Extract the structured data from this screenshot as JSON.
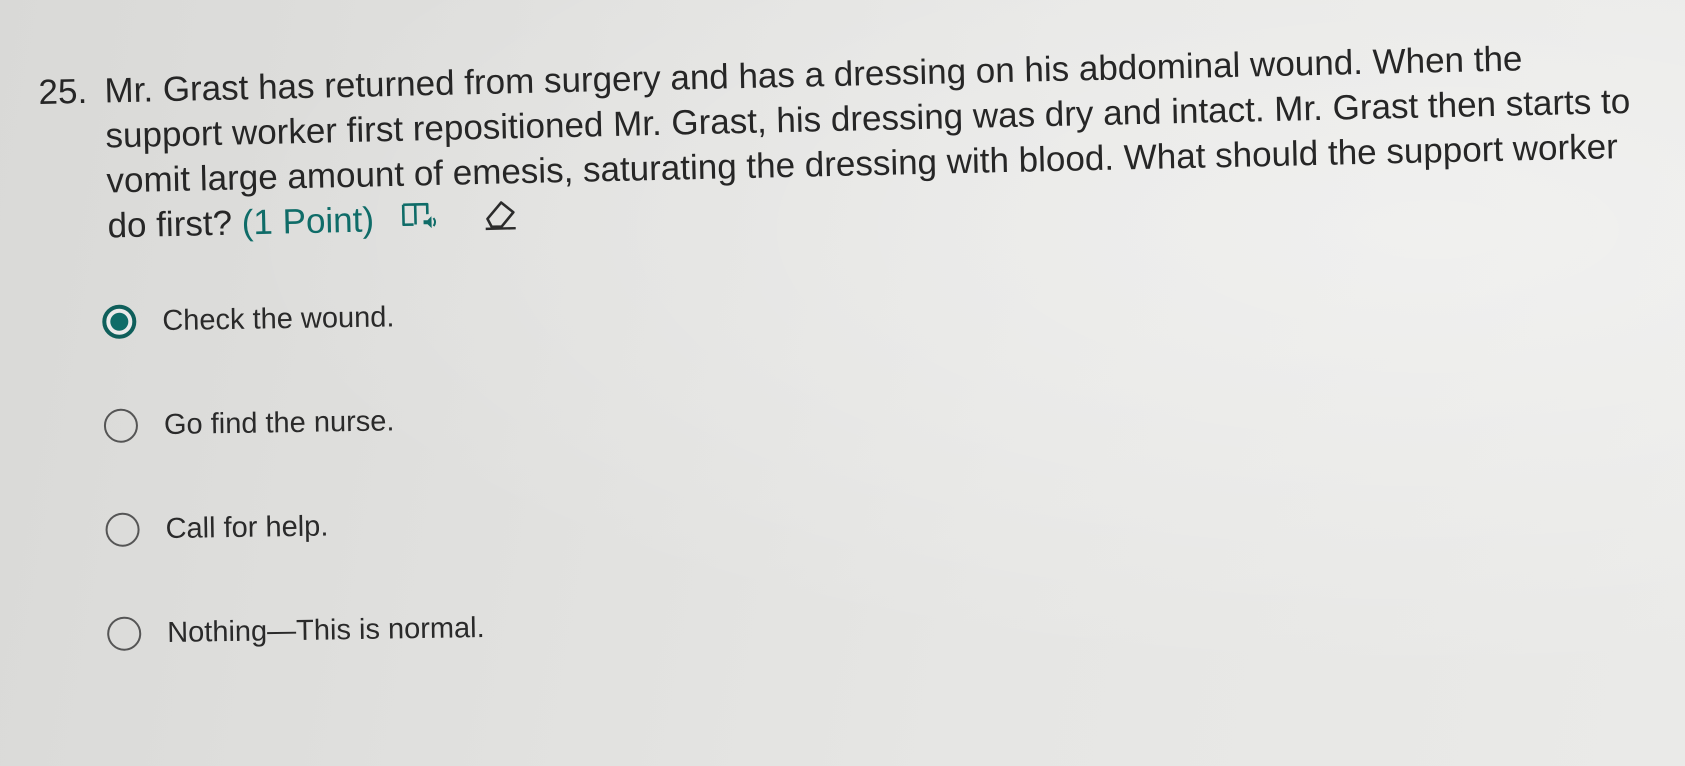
{
  "question": {
    "number": "25.",
    "text": "Mr. Grast has returned from surgery and has a dressing on his abdominal wound. When the support worker first repositioned Mr. Grast, his dressing was dry and intact. Mr. Grast then starts to vomit large amount of emesis, saturating the dressing with blood. What should the support worker do first?",
    "points": "(1 Point)",
    "icons": [
      "immersive-reader-icon",
      "eraser-icon"
    ]
  },
  "options": [
    {
      "label": "Check the wound.",
      "selected": true
    },
    {
      "label": "Go find the nurse.",
      "selected": false
    },
    {
      "label": "Call for help.",
      "selected": false
    },
    {
      "label": "Nothing—This is normal.",
      "selected": false
    }
  ],
  "colors": {
    "accent": "#0f6c68",
    "text": "#2b2b2b"
  }
}
